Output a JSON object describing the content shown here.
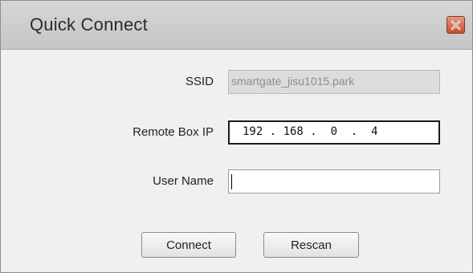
{
  "window": {
    "title": "Quick Connect",
    "close_icon": "close-icon"
  },
  "form": {
    "ssid": {
      "label": "SSID",
      "value": "smartgate_jisu1015.park"
    },
    "remote_ip": {
      "label": "Remote Box IP",
      "octets": [
        "192",
        "168",
        "0",
        "4"
      ],
      "display": "192 . 168 .  0  .  4"
    },
    "user_name": {
      "label": "User Name",
      "value": ""
    }
  },
  "buttons": {
    "connect": "Connect",
    "rescan": "Rescan"
  },
  "colors": {
    "titlebar": "#cfcfcf",
    "close_button": "#d9694e",
    "dialog_background": "#f0f0f0"
  }
}
